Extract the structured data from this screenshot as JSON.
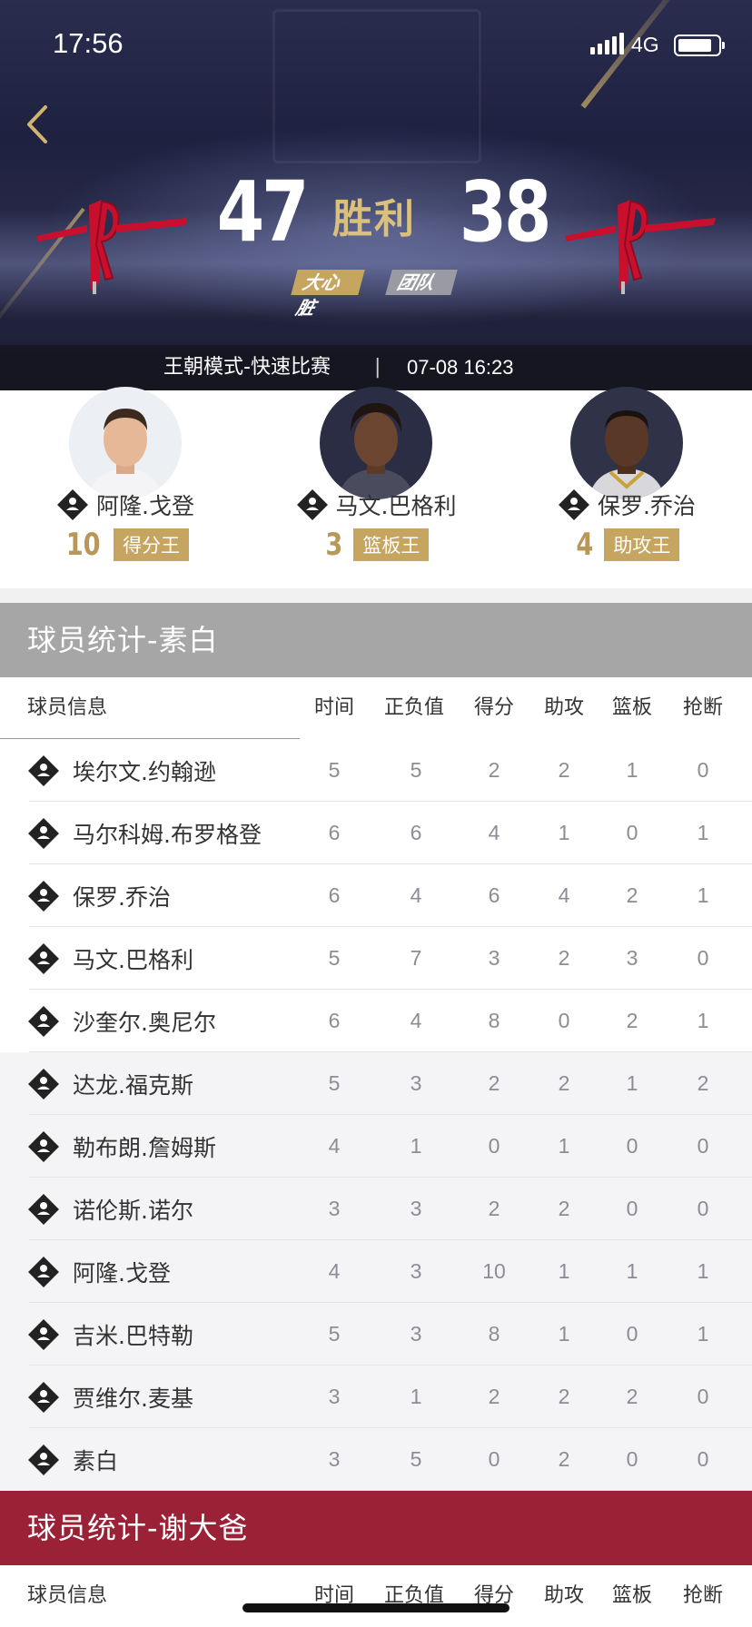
{
  "status_bar": {
    "time": "17:56",
    "network": "4G"
  },
  "header": {
    "home_score": "47",
    "away_score": "38",
    "result": "胜利",
    "tags": [
      "大心脏",
      "团队"
    ],
    "mode": "王朝模式-快速比赛",
    "separator": "|",
    "date": "07-08 16:23",
    "logo_text": "HOUSTON ROCKETS"
  },
  "leaders": [
    {
      "name": "阿隆.戈登",
      "value": "10",
      "label": "得分王"
    },
    {
      "name": "马文.巴格利",
      "value": "3",
      "label": "篮板王"
    },
    {
      "name": "保罗.乔治",
      "value": "4",
      "label": "助攻王"
    }
  ],
  "section1": {
    "title": "球员统计-素白",
    "columns": [
      "球员信息",
      "时间",
      "正负值",
      "得分",
      "助攻",
      "篮板",
      "抢断"
    ],
    "rows": [
      {
        "name": "埃尔文.约翰逊",
        "stats": [
          "5",
          "5",
          "2",
          "2",
          "1",
          "0"
        ]
      },
      {
        "name": "马尔科姆.布罗格登",
        "stats": [
          "6",
          "6",
          "4",
          "1",
          "0",
          "1"
        ]
      },
      {
        "name": "保罗.乔治",
        "stats": [
          "6",
          "4",
          "6",
          "4",
          "2",
          "1"
        ]
      },
      {
        "name": "马文.巴格利",
        "stats": [
          "5",
          "7",
          "3",
          "2",
          "3",
          "0"
        ]
      },
      {
        "name": "沙奎尔.奥尼尔",
        "stats": [
          "6",
          "4",
          "8",
          "0",
          "2",
          "1"
        ]
      },
      {
        "name": "达龙.福克斯",
        "stats": [
          "5",
          "3",
          "2",
          "2",
          "1",
          "2"
        ]
      },
      {
        "name": "勒布朗.詹姆斯",
        "stats": [
          "4",
          "1",
          "0",
          "1",
          "0",
          "0"
        ]
      },
      {
        "name": "诺伦斯.诺尔",
        "stats": [
          "3",
          "3",
          "2",
          "2",
          "0",
          "0"
        ]
      },
      {
        "name": "阿隆.戈登",
        "stats": [
          "4",
          "3",
          "10",
          "1",
          "1",
          "1"
        ]
      },
      {
        "name": "吉米.巴特勒",
        "stats": [
          "5",
          "3",
          "8",
          "1",
          "0",
          "1"
        ]
      },
      {
        "name": "贾维尔.麦基",
        "stats": [
          "3",
          "1",
          "2",
          "2",
          "2",
          "0"
        ]
      },
      {
        "name": "素白",
        "stats": [
          "3",
          "5",
          "0",
          "2",
          "0",
          "0"
        ]
      }
    ]
  },
  "section2": {
    "title": "球员统计-谢大爸",
    "columns": [
      "球员信息",
      "时间",
      "正负值",
      "得分",
      "助攻",
      "篮板",
      "抢断"
    ]
  },
  "colors": {
    "gold": "#c5a560",
    "section_grey": "#a6a6a6",
    "section_red": "#9a2136"
  }
}
